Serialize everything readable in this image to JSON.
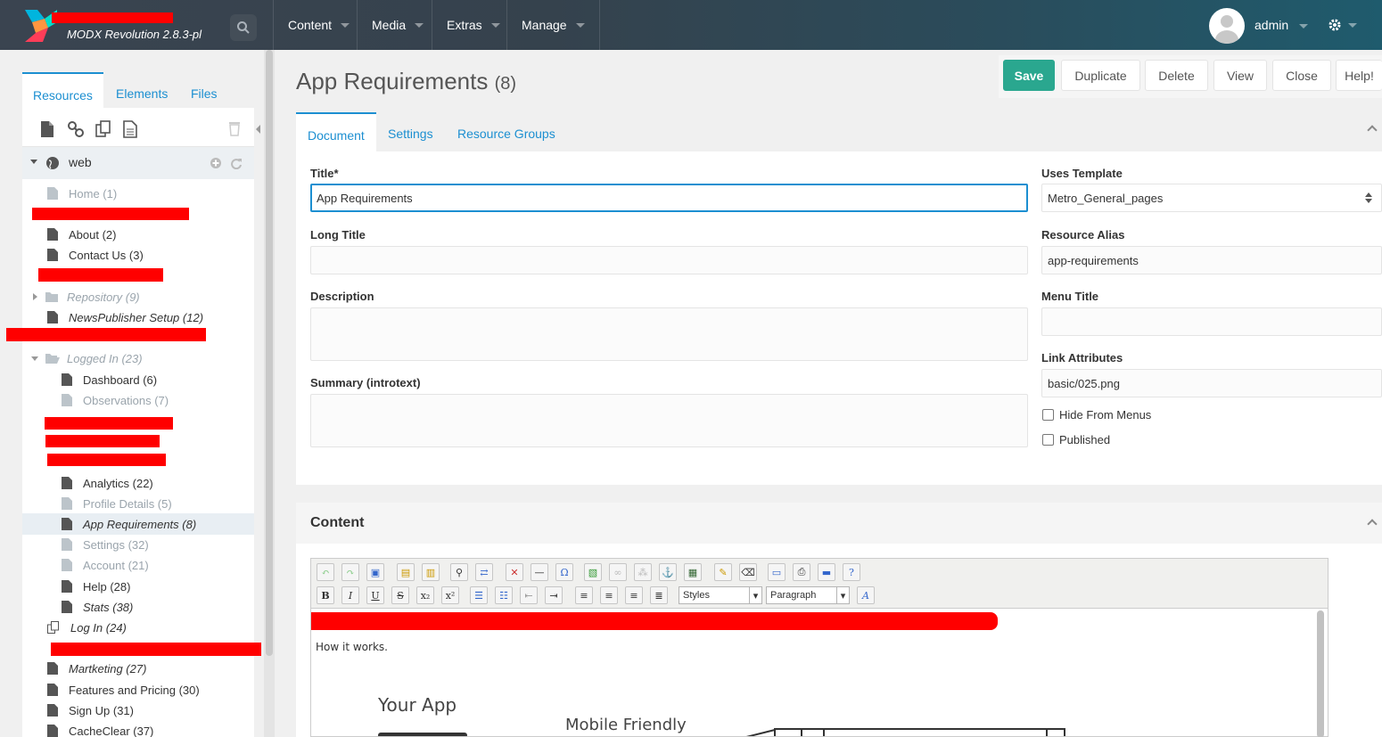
{
  "header": {
    "version": "MODX Revolution 2.8.3-pl",
    "nav": [
      "Content",
      "Media",
      "Extras",
      "Manage"
    ],
    "user": "admin"
  },
  "left": {
    "tabs": [
      "Resources",
      "Elements",
      "Files"
    ],
    "context": "web",
    "tree": [
      {
        "label": "Home (1)",
        "style": "dim"
      },
      {
        "label": "About (2)",
        "style": "normal"
      },
      {
        "label": "Contact Us (3)",
        "style": "normal"
      },
      {
        "label": "Repository (9)",
        "style": "dim-ital-folder"
      },
      {
        "label": "NewsPublisher Setup (12)",
        "style": "ital"
      },
      {
        "label": "Logged In (23)",
        "style": "dim-ital-folder-open"
      },
      {
        "label": "Dashboard (6)",
        "style": "normal"
      },
      {
        "label": "Observations (7)",
        "style": "dim"
      },
      {
        "label": "Analytics (22)",
        "style": "normal"
      },
      {
        "label": "Profile Details (5)",
        "style": "dim"
      },
      {
        "label": "App Requirements (8)",
        "style": "ital-selected"
      },
      {
        "label": "Settings (32)",
        "style": "dim"
      },
      {
        "label": "Account (21)",
        "style": "dim"
      },
      {
        "label": "Help (28)",
        "style": "normal"
      },
      {
        "label": "Stats (38)",
        "style": "ital"
      },
      {
        "label": "Log In (24)",
        "style": "ital"
      },
      {
        "label": "Martketing (27)",
        "style": "ital"
      },
      {
        "label": "Features and Pricing (30)",
        "style": "normal"
      },
      {
        "label": "Sign Up (31)",
        "style": "normal"
      },
      {
        "label": "CacheClear (37)",
        "style": "normal"
      }
    ]
  },
  "main": {
    "title": "App Requirements",
    "title_id": "(8)",
    "actions": [
      "Save",
      "Duplicate",
      "Delete",
      "View",
      "Close",
      "Help!"
    ],
    "tabs": [
      "Document",
      "Settings",
      "Resource Groups"
    ],
    "fields": {
      "title_label": "Title*",
      "title_value": "App Requirements",
      "longtitle_label": "Long Title",
      "description_label": "Description",
      "summary_label": "Summary (introtext)",
      "template_label": "Uses Template",
      "template_value": "Metro_General_pages",
      "alias_label": "Resource Alias",
      "alias_value": "app-requirements",
      "menutitle_label": "Menu Title",
      "linkattr_label": "Link Attributes",
      "linkattr_value": "basic/025.png",
      "hide_menus": "Hide From Menus",
      "published": "Published"
    },
    "content": {
      "title": "Content",
      "styles_select": "Styles",
      "format_select": "Paragraph",
      "body_text": "How it works.",
      "figure_label_1": "Your App",
      "figure_label_2": "Mobile Friendly"
    }
  },
  "colors": {
    "accent": "#1c8fd1",
    "save": "#2aa78f",
    "redaction": "#ff0000"
  }
}
